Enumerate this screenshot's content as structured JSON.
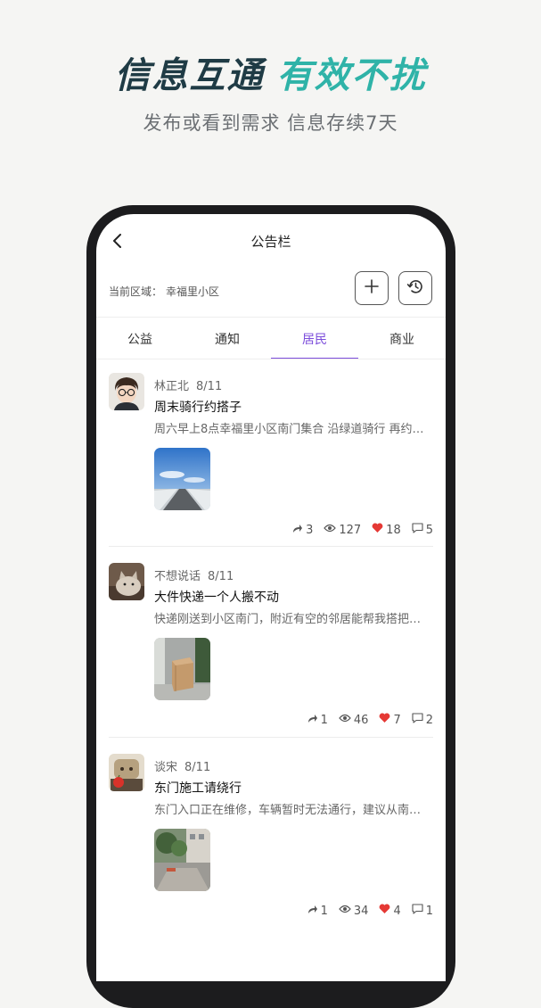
{
  "promo": {
    "title_dark": "信息互通",
    "title_accent": "有效不扰",
    "subtitle": "发布或看到需求 信息存续7天"
  },
  "nav": {
    "title": "公告栏"
  },
  "area": {
    "label": "当前区域：",
    "value": "幸福里小区"
  },
  "tabs": [
    {
      "label": "公益",
      "active": false
    },
    {
      "label": "通知",
      "active": false
    },
    {
      "label": "居民",
      "active": true
    },
    {
      "label": "商业",
      "active": false
    }
  ],
  "posts": [
    {
      "author": "林正北",
      "date": "8/11",
      "title": "周末骑行约搭子",
      "body": "周六早上8点幸福里小区南门集合 沿绿道骑行 再约…",
      "stats": {
        "shares": "3",
        "views": "127",
        "likes": "18",
        "comments": "5"
      }
    },
    {
      "author": "不想说话",
      "date": "8/11",
      "title": "大件快递一个人搬不动",
      "body": "快递刚送到小区南门，附近有空的邻居能帮我搭把手…",
      "stats": {
        "shares": "1",
        "views": "46",
        "likes": "7",
        "comments": "2"
      }
    },
    {
      "author": "谈宋",
      "date": "8/11",
      "title": "东门施工请绕行",
      "body": "东门入口正在维修，车辆暂时无法通行，建议从南门…",
      "stats": {
        "shares": "1",
        "views": "34",
        "likes": "4",
        "comments": "1"
      }
    }
  ],
  "colors": {
    "accent": "#2fb3a8",
    "title_dark": "#1f3b45",
    "tab_active": "#7c4ddb",
    "like_red": "#e53935"
  },
  "icons": [
    "back-icon",
    "plus-icon",
    "history-icon",
    "share-icon",
    "eye-icon",
    "heart-icon",
    "comment-icon"
  ]
}
